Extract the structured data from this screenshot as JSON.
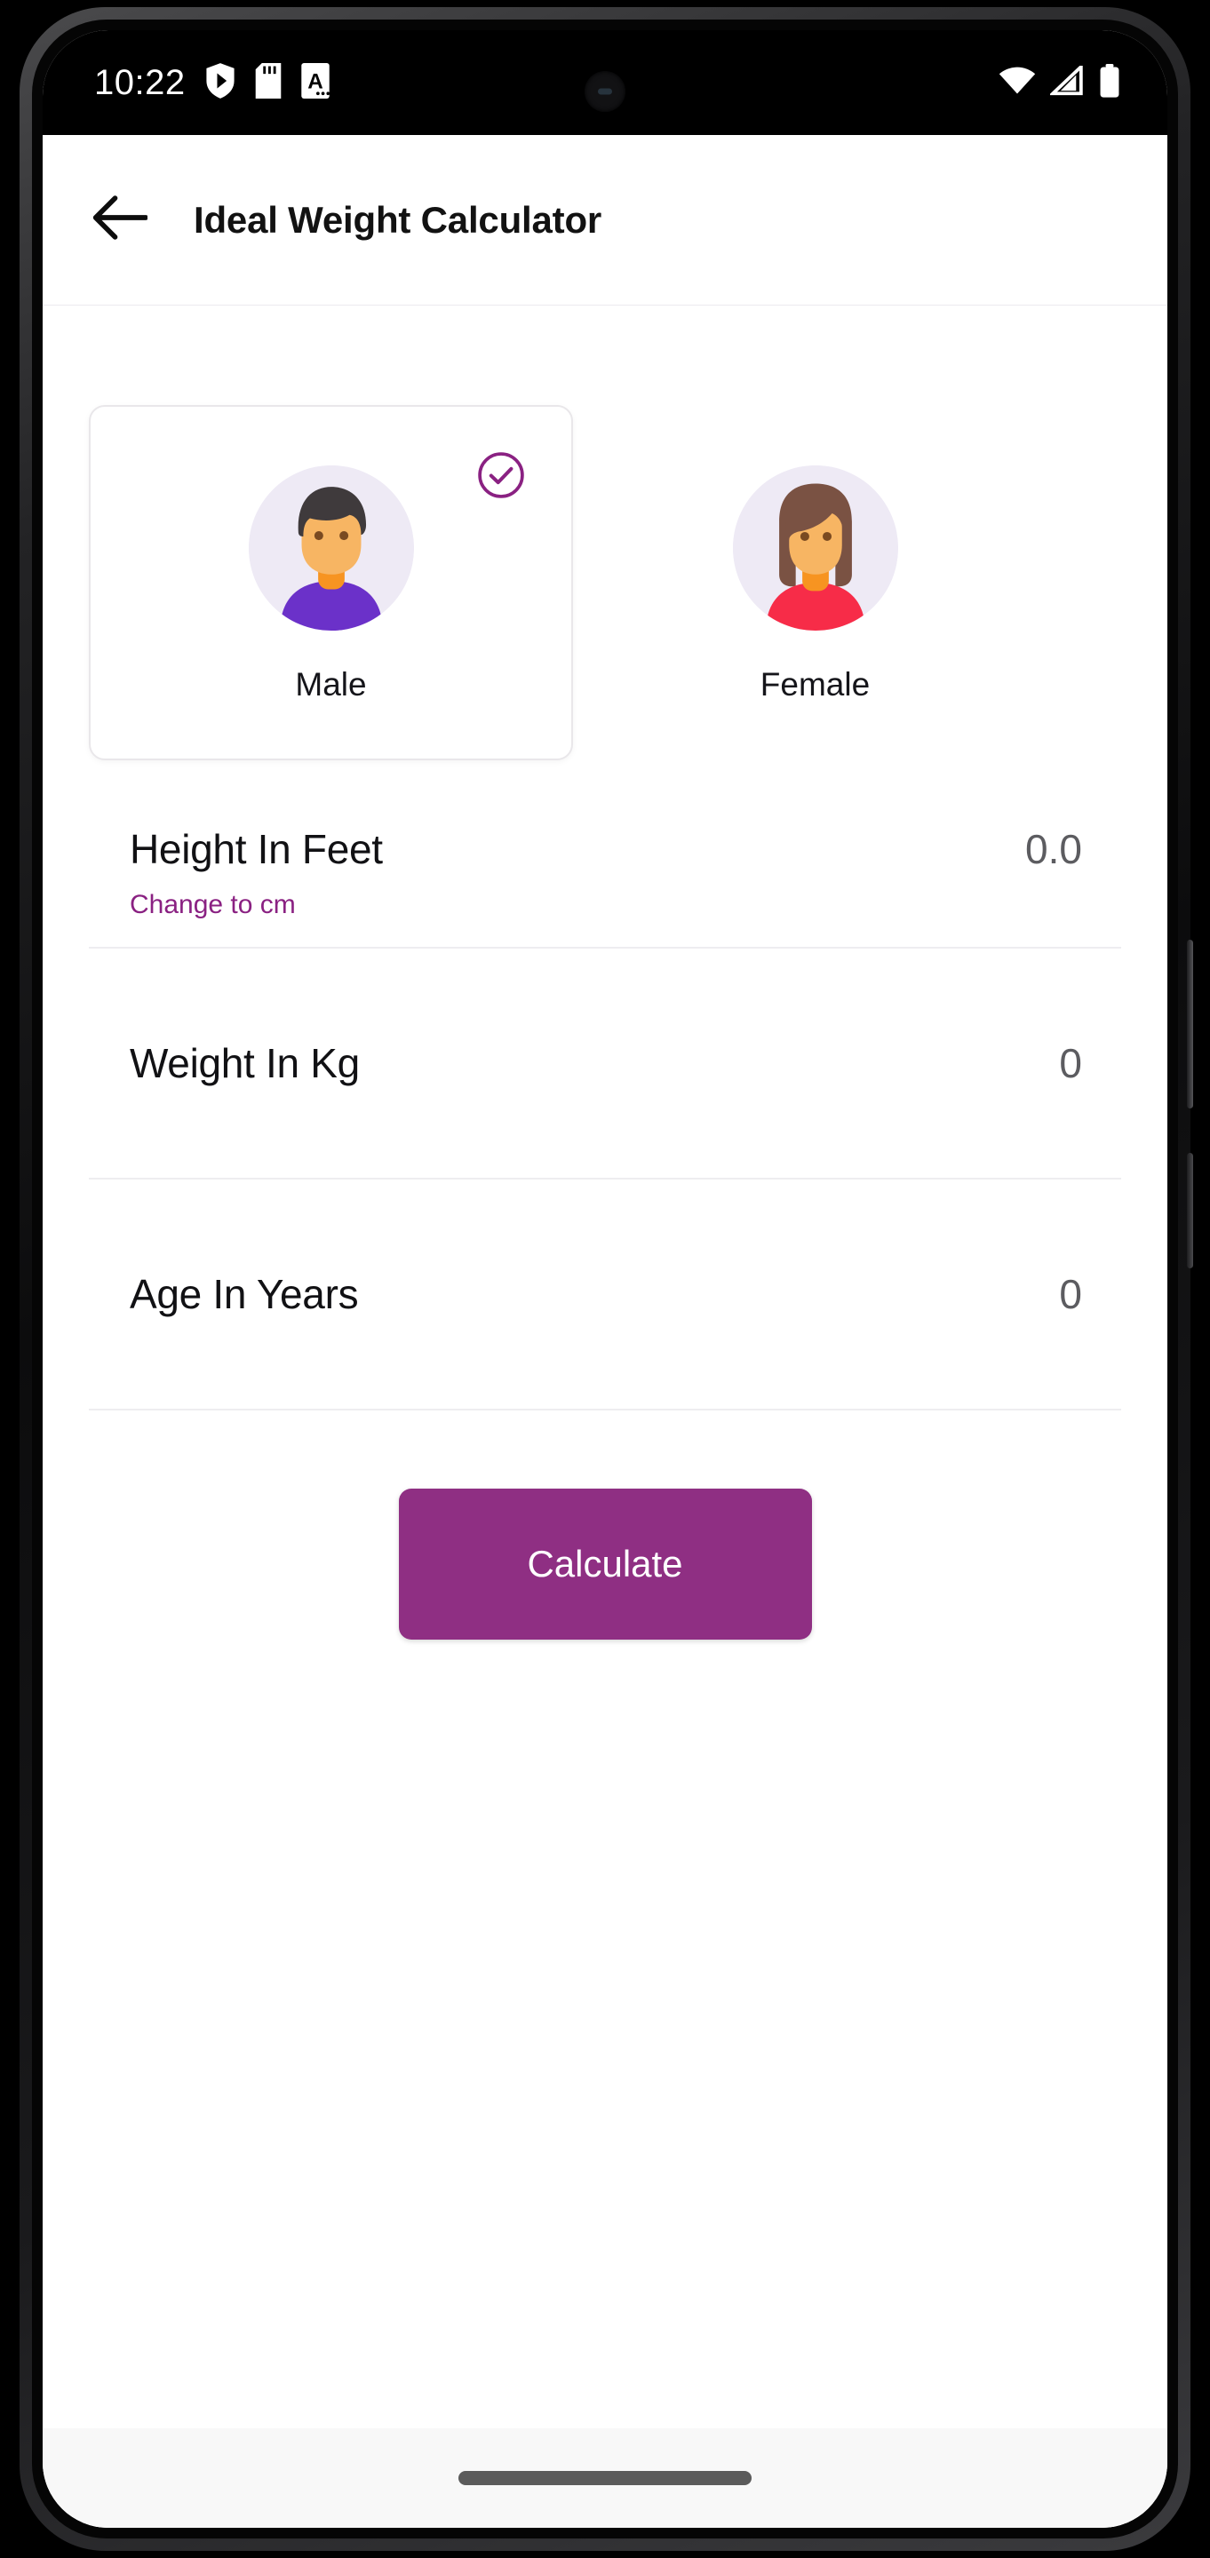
{
  "statusbar": {
    "time": "10:22",
    "left_icons": [
      "play-protect-icon",
      "sd-card-icon",
      "font-a-icon"
    ],
    "right_icons": [
      "wifi-icon",
      "cellular-signal-icon",
      "battery-icon"
    ],
    "background": "#000000",
    "foreground": "#ffffff"
  },
  "appbar": {
    "back_icon": "arrow-left-icon",
    "title": "Ideal Weight Calculator"
  },
  "gender": {
    "options": [
      {
        "id": "male",
        "label": "Male",
        "selected": true,
        "check_icon": "check-circle-icon",
        "avatar": {
          "hair": "#3f3a3c",
          "skin": "#f7b563",
          "shirt": "#6b31c9",
          "neck": "#f79421",
          "bg": "#eeeaf5"
        }
      },
      {
        "id": "female",
        "label": "Female",
        "selected": false,
        "avatar": {
          "hair": "#7a5243",
          "skin": "#f7b563",
          "shirt": "#f72c48",
          "neck": "#f79421",
          "bg": "#eeeaf5"
        }
      }
    ],
    "selected_accent": "#8a2182"
  },
  "fields": [
    {
      "id": "height",
      "label": "Height In Feet",
      "value": "0.0",
      "sub_link": "Change to cm",
      "has_sub": true
    },
    {
      "id": "weight",
      "label": "Weight In Kg",
      "value": "0",
      "sub_link": "",
      "has_sub": false
    },
    {
      "id": "age",
      "label": "Age In Years",
      "value": "0",
      "sub_link": "",
      "has_sub": false
    }
  ],
  "cta": {
    "label": "Calculate",
    "color": "#8f2f83",
    "text_color": "#ffffff"
  },
  "navigation": {
    "gesture_pill": "home-gesture-pill"
  },
  "theme": {
    "accent": "#8a2182",
    "button": "#8f2f83",
    "page_bg": "#ffffff",
    "divider": "#eeedf0",
    "label_text": "#111114",
    "value_text": "#5c5c60"
  }
}
